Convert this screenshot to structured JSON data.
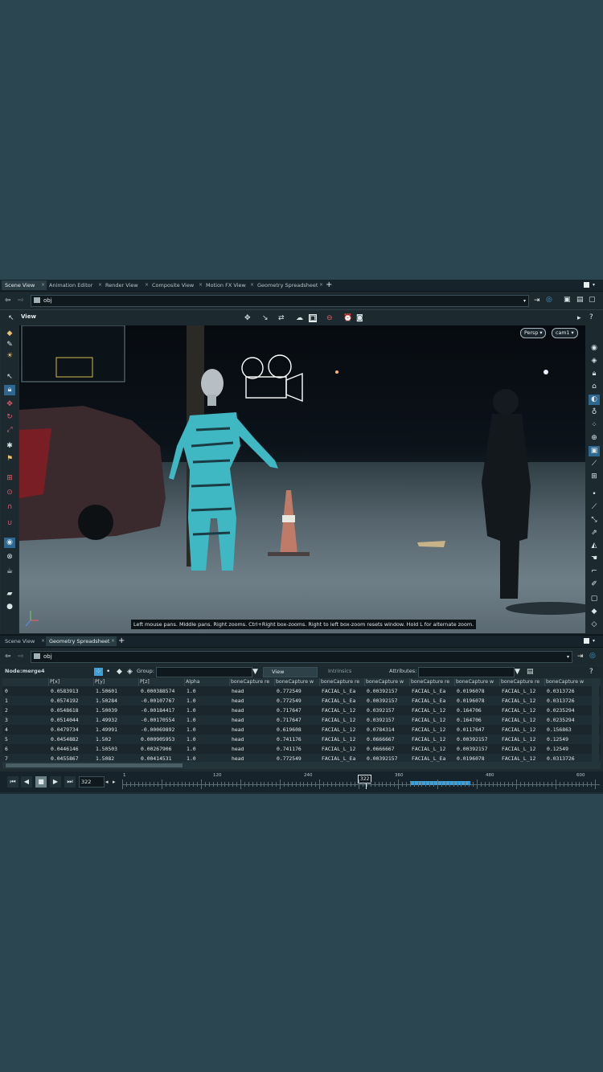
{
  "top_tabs": [
    "Scene View",
    "Animation Editor",
    "Render View",
    "Composite View",
    "Motion FX View",
    "Geometry Spreadsheet"
  ],
  "path": "obj",
  "view_label": "View",
  "viewport": {
    "persp_label": "Persp ▾",
    "camera_label": "cam1 ▾",
    "hint": "Left mouse pans. Middle pans. Right zooms. Ctrl+Right box-zooms. Right to left box-zoom resets window. Hold L for alternate zoom."
  },
  "bottom_tabs": [
    "Scene View",
    "Geometry Spreadsheet"
  ],
  "sheet_path": "obj",
  "spreadsheet_toolbar": {
    "node_label": "Node:",
    "node_value": "merge4",
    "group_label": "Group:",
    "view_label": "View",
    "intrinsics_label": "Intrinsics",
    "attributes_label": "Attributes:"
  },
  "spreadsheet": {
    "columns": [
      "",
      "P[x]",
      "P[y]",
      "P[z]",
      "Alpha",
      "boneCapture re",
      "boneCapture w",
      "boneCapture re",
      "boneCapture w",
      "boneCapture re",
      "boneCapture w",
      "boneCapture re",
      "boneCapture w"
    ],
    "rows": [
      [
        "0",
        "0.0583913",
        "1.50601",
        "0.000388574",
        "1.0",
        "head",
        "0.772549",
        "FACIAL_L_Ea",
        "0.00392157",
        "FACIAL_L_Ea",
        "0.0196078",
        "FACIAL_L_12",
        "0.0313726"
      ],
      [
        "1",
        "0.0574192",
        "1.50284",
        "-0.00107767",
        "1.0",
        "head",
        "0.772549",
        "FACIAL_L_Ea",
        "0.00392157",
        "FACIAL_L_Ea",
        "0.0196078",
        "FACIAL_L_12",
        "0.0313726"
      ],
      [
        "2",
        "0.0548618",
        "1.50039",
        "-0.00184417",
        "1.0",
        "head",
        "0.717647",
        "FACIAL_L_12",
        "0.0392157",
        "FACIAL_L_12",
        "0.164706",
        "FACIAL_L_12",
        "0.0235294"
      ],
      [
        "3",
        "0.0514044",
        "1.49932",
        "-0.00170554",
        "1.0",
        "head",
        "0.717647",
        "FACIAL_L_12",
        "0.0392157",
        "FACIAL_L_12",
        "0.164706",
        "FACIAL_L_12",
        "0.0235294"
      ],
      [
        "4",
        "0.0479734",
        "1.49991",
        "-0.00069892",
        "1.0",
        "head",
        "0.619608",
        "FACIAL_L_12",
        "0.0784314",
        "FACIAL_L_12",
        "0.0117647",
        "FACIAL_L_12",
        "0.156863"
      ],
      [
        "5",
        "0.0454882",
        "1.502",
        "0.000905953",
        "1.0",
        "head",
        "0.741176",
        "FACIAL_L_12",
        "0.0666667",
        "FACIAL_L_12",
        "0.00392157",
        "FACIAL_L_12",
        "0.12549"
      ],
      [
        "6",
        "0.0446146",
        "1.50503",
        "0.00267906",
        "1.0",
        "head",
        "0.741176",
        "FACIAL_L_12",
        "0.0666667",
        "FACIAL_L_12",
        "0.00392157",
        "FACIAL_L_12",
        "0.12549"
      ],
      [
        "7",
        "0.0455867",
        "1.5082",
        "0.00414531",
        "1.0",
        "head",
        "0.772549",
        "FACIAL_L_Ea",
        "0.00392157",
        "FACIAL_L_Ea",
        "0.0196078",
        "FACIAL_L_12",
        "0.0313726"
      ]
    ]
  },
  "timeline": {
    "current_frame": "322",
    "frame_marker": "322",
    "tick_labels": [
      "1",
      "120",
      "240",
      "360",
      "480",
      "600"
    ]
  },
  "colors": {
    "accent": "#3ea0d8",
    "mannequin": "#3fb8c3",
    "panel": "#1f2d33",
    "background": "#2b4650"
  }
}
